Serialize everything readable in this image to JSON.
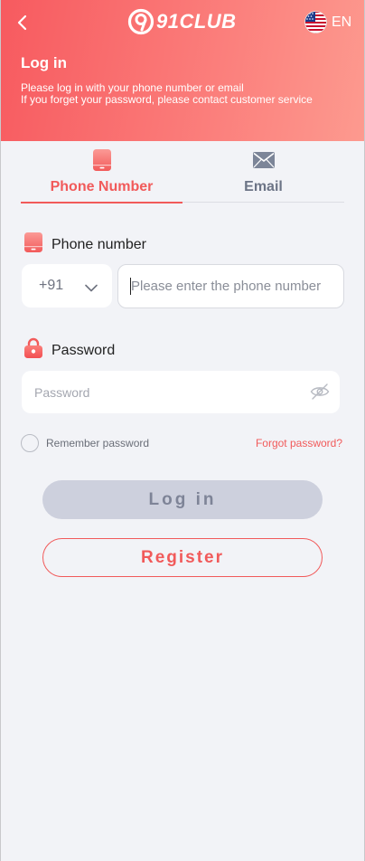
{
  "header": {
    "brand": "91CLUB",
    "language": "EN",
    "title": "Log in",
    "subtitle_line1": "Please log in with your phone number or email",
    "subtitle_line2": "If you forget your password, please contact customer service"
  },
  "tabs": [
    {
      "label": "Phone Number",
      "icon": "phone-icon",
      "active": true
    },
    {
      "label": "Email",
      "icon": "email-icon",
      "active": false
    }
  ],
  "phone_field": {
    "label": "Phone number",
    "icon": "phone-icon",
    "country_code": "+91",
    "placeholder": "Please enter the phone number",
    "value": ""
  },
  "password_field": {
    "label": "Password",
    "icon": "lock-icon",
    "placeholder": "Password",
    "value": ""
  },
  "remember": {
    "label": "Remember password",
    "checked": false
  },
  "forgot": "Forgot password?",
  "buttons": {
    "login": "Log in",
    "register": "Register"
  },
  "colors": {
    "accent": "#f15a5a",
    "header_gradient_start": "#f75a5f",
    "header_gradient_end": "#fd9a8f",
    "background": "#f2f3f7",
    "login_button_bg": "#cdd0dd"
  }
}
